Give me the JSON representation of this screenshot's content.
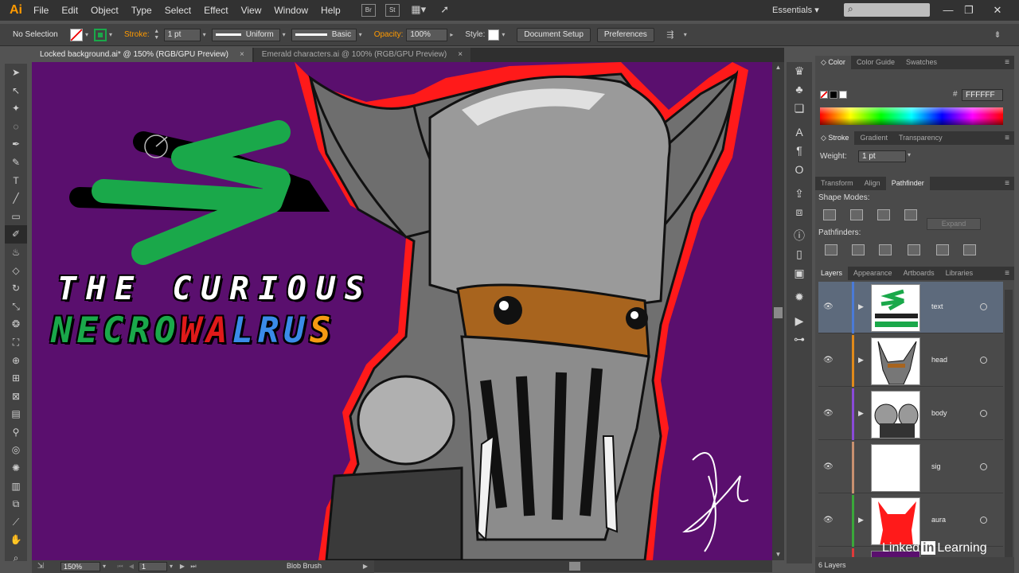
{
  "app": {
    "logo": "Ai",
    "workspace": "Essentials"
  },
  "menu": [
    "File",
    "Edit",
    "Object",
    "Type",
    "Select",
    "Effect",
    "View",
    "Window",
    "Help"
  ],
  "menu_icons": [
    "Br",
    "St"
  ],
  "control": {
    "selection": "No Selection",
    "stroke_label": "Stroke:",
    "stroke_weight": "1 pt",
    "profile": "Uniform",
    "brush": "Basic",
    "opacity_label": "Opacity:",
    "opacity": "100%",
    "style_label": "Style:",
    "document_setup": "Document Setup",
    "preferences": "Preferences"
  },
  "tabs": [
    {
      "label": "Locked background.ai* @ 150% (RGB/GPU Preview)",
      "close": "×",
      "active": true
    },
    {
      "label": "Emerald characters.ai @ 100% (RGB/GPU Preview)",
      "close": "×",
      "active": false
    }
  ],
  "canvas": {
    "title_line1": "THE CURIOUS",
    "title_line2": [
      {
        "text": "NECRO",
        "color": "#1aa84a"
      },
      {
        "text": "WA",
        "color": "#e01a1a"
      },
      {
        "text": "L",
        "color": "#3a8be8"
      },
      {
        "text": "RU",
        "color": "#3a8be8"
      },
      {
        "text": "S",
        "color": "#f59a12"
      }
    ],
    "background_color": "#5a0f6e",
    "brush_stroke_color": "#1aa84a"
  },
  "status": {
    "zoom": "150%",
    "artboard": "1",
    "tool": "Blob Brush"
  },
  "color_panel": {
    "tabs": [
      "Color",
      "Color Guide",
      "Swatches"
    ],
    "hash": "#",
    "hex": "FFFFFF"
  },
  "stroke_panel": {
    "tabs": [
      "Stroke",
      "Gradient",
      "Transparency"
    ],
    "weight_label": "Weight:",
    "weight": "1 pt"
  },
  "pathfinder_panel": {
    "tabs": [
      "Transform",
      "Align",
      "Pathfinder"
    ],
    "shape_modes": "Shape Modes:",
    "pathfinders": "Pathfinders:",
    "expand": "Expand"
  },
  "layers_panel": {
    "tabs": [
      "Layers",
      "Appearance",
      "Artboards",
      "Libraries"
    ],
    "layers": [
      {
        "name": "text",
        "color": "#4a7ad8",
        "selected": true,
        "has_arrow": true
      },
      {
        "name": "head",
        "color": "#e08a1a",
        "selected": false,
        "has_arrow": true
      },
      {
        "name": "body",
        "color": "#8a4ad8",
        "selected": false,
        "has_arrow": true
      },
      {
        "name": "sig",
        "color": "#c89070",
        "selected": false,
        "has_arrow": false
      },
      {
        "name": "aura",
        "color": "#3aa83a",
        "selected": false,
        "has_arrow": true
      }
    ],
    "footer": "6 Layers"
  },
  "watermark": {
    "prefix": "Linked",
    "in": "in",
    "suffix": "Learning"
  },
  "icons": {
    "tools": [
      "selection-icon",
      "direct-selection-icon",
      "magic-wand-icon",
      "lasso-icon",
      "pen-icon",
      "curvature-icon",
      "type-icon",
      "line-icon",
      "rectangle-icon",
      "blob-brush-icon",
      "paintbrush-icon",
      "eraser-icon",
      "rotate-icon",
      "scale-icon",
      "warp-icon",
      "free-transform-icon",
      "shape-builder-icon",
      "perspective-icon",
      "mesh-icon",
      "gradient-icon",
      "eyedropper-icon",
      "blend-icon",
      "symbol-sprayer-icon",
      "column-graph-icon",
      "artboard-icon",
      "slice-icon",
      "hand-icon",
      "zoom-icon"
    ]
  }
}
